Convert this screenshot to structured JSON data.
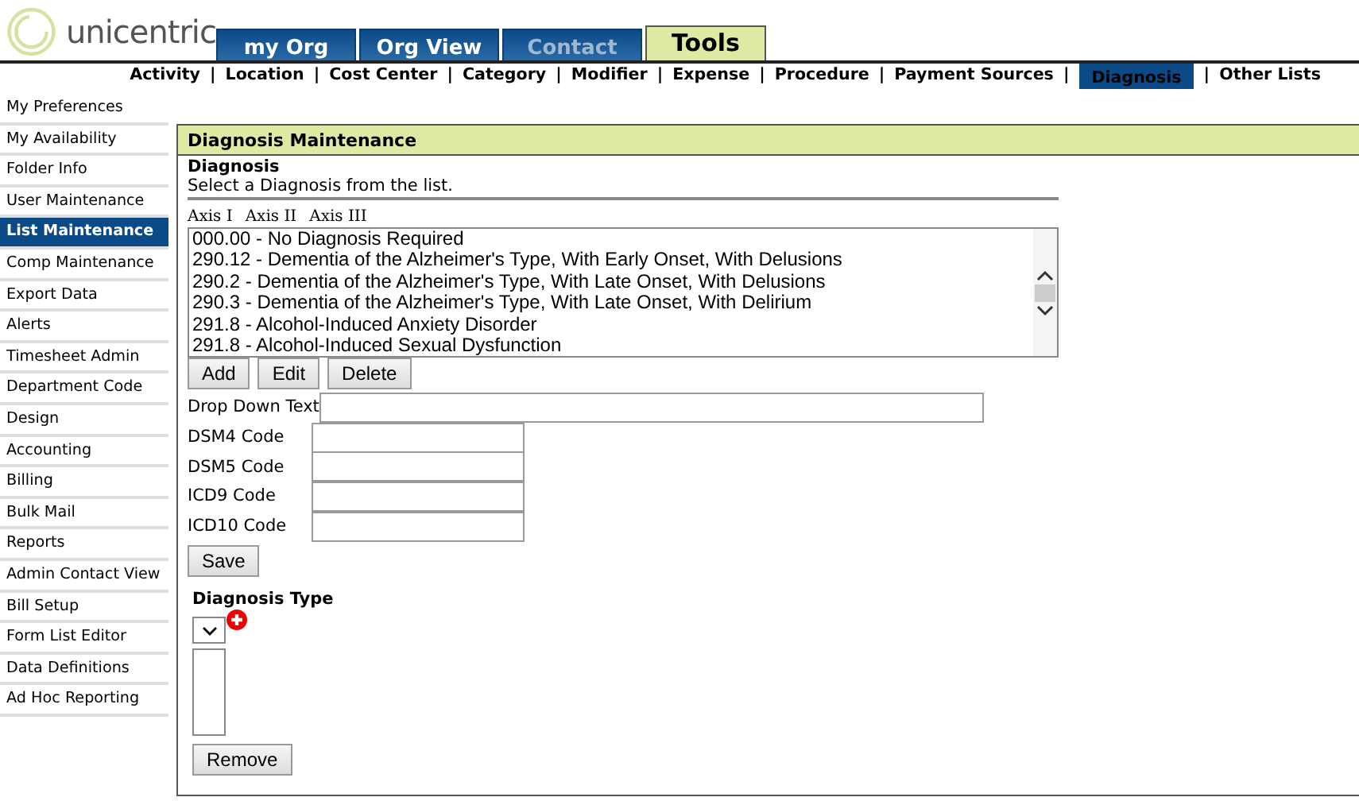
{
  "logo": {
    "text": "unicentric"
  },
  "tabs": [
    {
      "label": "my Org",
      "selected": false,
      "disabled": false
    },
    {
      "label": "Org View",
      "selected": false,
      "disabled": false
    },
    {
      "label": "Contact",
      "selected": false,
      "disabled": true
    },
    {
      "label": "Tools",
      "selected": true,
      "disabled": false
    }
  ],
  "subnav": [
    {
      "label": "Activity",
      "selected": false,
      "separator": "|"
    },
    {
      "label": "Location",
      "selected": false,
      "separator": "|"
    },
    {
      "label": "Cost Center",
      "selected": false,
      "separator": "|"
    },
    {
      "label": "Category",
      "selected": false,
      "separator": "|"
    },
    {
      "label": "Modifier",
      "selected": false,
      "separator": "|"
    },
    {
      "label": "Expense",
      "selected": false,
      "separator": "|"
    },
    {
      "label": "Procedure",
      "selected": false,
      "separator": "|"
    },
    {
      "label": "Payment Sources",
      "selected": false,
      "separator": "|"
    },
    {
      "label": "Diagnosis",
      "selected": true,
      "separator": "|"
    },
    {
      "label": "Other Lists",
      "selected": false
    }
  ],
  "sidebar": {
    "items": [
      {
        "label": "My Preferences",
        "selected": false
      },
      {
        "label": "My Availability",
        "selected": false
      },
      {
        "label": "Folder Info",
        "selected": false
      },
      {
        "label": "User Maintenance",
        "selected": false
      },
      {
        "label": "List Maintenance",
        "selected": true
      },
      {
        "label": "Comp Maintenance",
        "selected": false
      },
      {
        "label": "Export Data",
        "selected": false
      },
      {
        "label": "Alerts",
        "selected": false
      },
      {
        "label": "Timesheet Admin",
        "selected": false
      },
      {
        "label": "Department Code",
        "selected": false
      },
      {
        "label": "Design",
        "selected": false
      },
      {
        "label": "Accounting",
        "selected": false
      },
      {
        "label": "Billing",
        "selected": false
      },
      {
        "label": "Bulk Mail",
        "selected": false
      },
      {
        "label": "Reports",
        "selected": false
      },
      {
        "label": "Admin Contact View",
        "selected": false
      },
      {
        "label": "Bill Setup",
        "selected": false
      },
      {
        "label": "Form List Editor",
        "selected": false
      },
      {
        "label": "Data Definitions",
        "selected": false
      },
      {
        "label": "Ad Hoc Reporting",
        "selected": false
      }
    ]
  },
  "panel": {
    "title": "Diagnosis Maintenance",
    "section_title": "Diagnosis",
    "instructions": "Select a Diagnosis from the list.",
    "axis_tabs": [
      "Axis I",
      "Axis II",
      "Axis III"
    ],
    "diagnosis_list": [
      "000.00 - No Diagnosis Required",
      "290.12 - Dementia of the Alzheimer's Type, With Early Onset, With Delusions",
      "290.2 - Dementia of the Alzheimer's Type, With Late Onset, With Delusions",
      "290.3 - Dementia of the Alzheimer's Type, With Late Onset, With Delirium",
      "291.8 - Alcohol-Induced Anxiety Disorder",
      "291.8 - Alcohol-Induced Sexual Dysfunction"
    ],
    "list_buttons": [
      "Add",
      "Edit",
      "Delete"
    ],
    "fields": [
      {
        "label": "Drop Down Text",
        "kind": "wide"
      },
      {
        "label": "DSM4 Code",
        "kind": "short"
      },
      {
        "label": "DSM5 Code",
        "kind": "short"
      },
      {
        "label": "ICD9 Code",
        "kind": "short"
      },
      {
        "label": "ICD10 Code",
        "kind": "short"
      }
    ],
    "save_button": "Save",
    "type_title": "Diagnosis Type",
    "remove_button": "Remove"
  }
}
